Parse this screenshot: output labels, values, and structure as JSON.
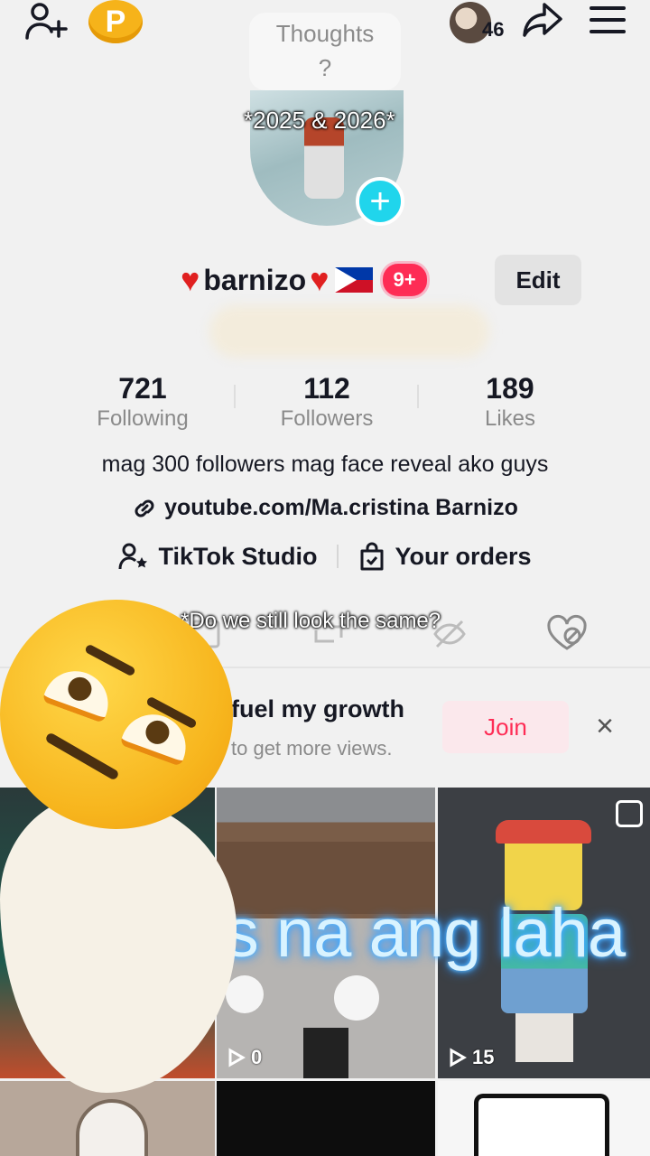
{
  "topbar": {
    "thoughts_label": "Thoughts",
    "thoughts_prompt": "?",
    "coin_letter": "P",
    "visitor_count": "46"
  },
  "captions": {
    "top": "*2025 & 2026*",
    "middle": "*Do we still look the same?",
    "overlay": "Tapos na ang laha"
  },
  "profile": {
    "username": "barnizo",
    "notification_badge": "9+",
    "edit_label": "Edit"
  },
  "stats": [
    {
      "value": "721",
      "label": "Following"
    },
    {
      "value": "112",
      "label": "Followers"
    },
    {
      "value": "189",
      "label": "Likes"
    }
  ],
  "bio": "mag 300 followers mag face reveal ako guys",
  "link": "youtube.com/Ma.cristina Barnizo",
  "tools": {
    "studio_label": "TikTok Studio",
    "orders_label": "Your orders"
  },
  "promo": {
    "title": "fuel my growth",
    "subtitle": "to get more views.",
    "join_label": "Join",
    "close_label": "×"
  },
  "grid": [
    {
      "views": ""
    },
    {
      "views": "0"
    },
    {
      "views": "15"
    }
  ],
  "colors": {
    "accent": "#fe2c55",
    "plus_badge": "#20d5ec",
    "coin": "#f6b31a"
  }
}
